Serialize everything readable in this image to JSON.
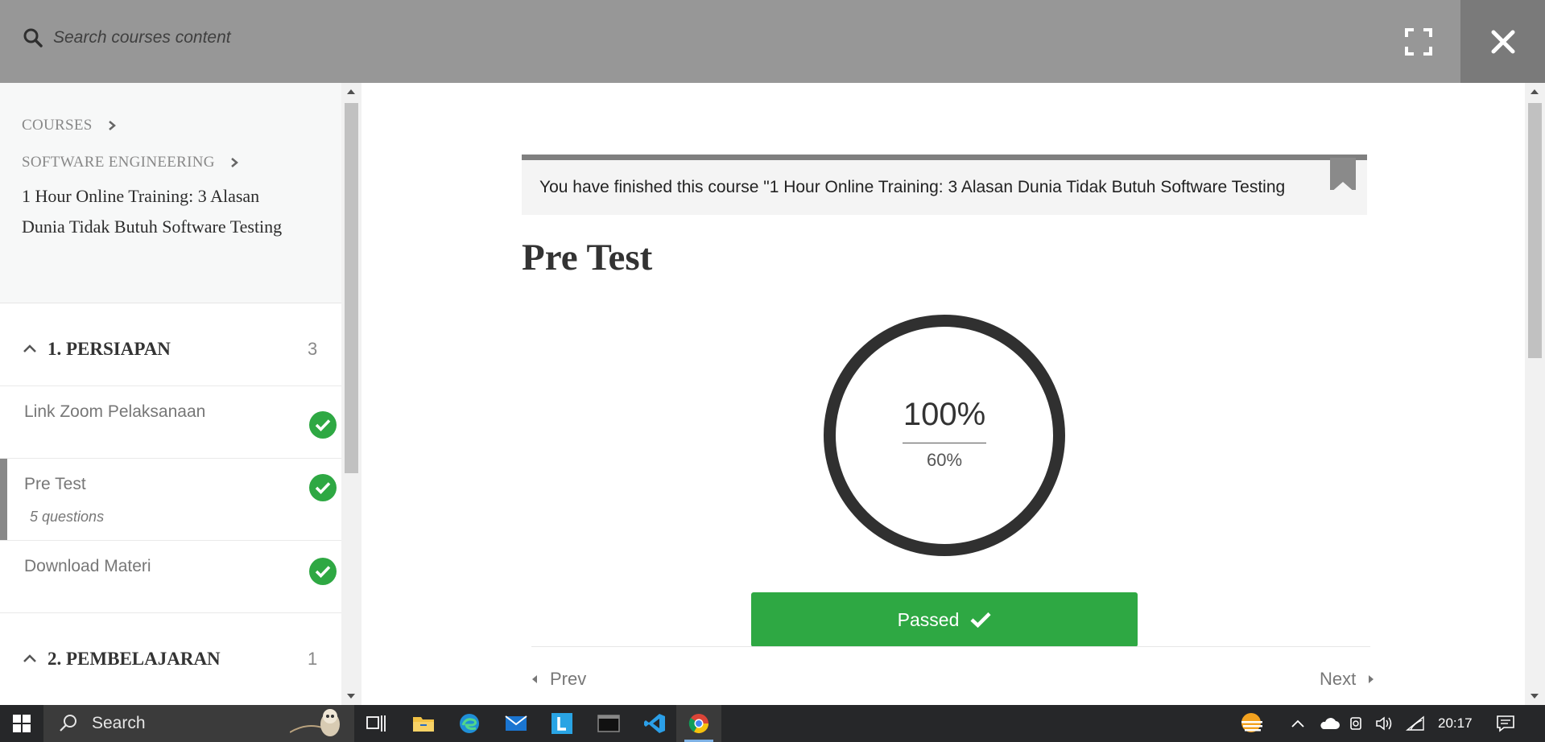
{
  "topbar": {
    "search_placeholder": "Search courses content"
  },
  "sidebar": {
    "breadcrumb": [
      "COURSES",
      "SOFTWARE ENGINEERING"
    ],
    "course_title": "1 Hour Online Training: 3 Alasan Dunia Tidak Butuh Software Testing",
    "sections": [
      {
        "title": "1. PERSIAPAN",
        "count": "3",
        "items": [
          {
            "label": "Link Zoom Pelaksanaan",
            "sub": "",
            "completed": true,
            "active": false
          },
          {
            "label": "Pre Test",
            "sub": "5 questions",
            "completed": true,
            "active": true
          },
          {
            "label": "Download Materi",
            "sub": "",
            "completed": true,
            "active": false
          }
        ]
      },
      {
        "title": "2. PEMBELAJARAN",
        "count": "1"
      }
    ]
  },
  "main": {
    "notice": "You have finished this course \"1 Hour Online Training: 3 Alasan Dunia Tidak Butuh Software Testing",
    "quiz_title": "Pre Test",
    "score": "100%",
    "passing_grade": "60%",
    "result_label": "Passed",
    "prev_label": "Prev",
    "next_label": "Next"
  },
  "taskbar": {
    "search_label": "Search",
    "time": "20:17"
  },
  "colors": {
    "topbar": "#979797",
    "success": "#2ea843",
    "ring": "#303030"
  }
}
